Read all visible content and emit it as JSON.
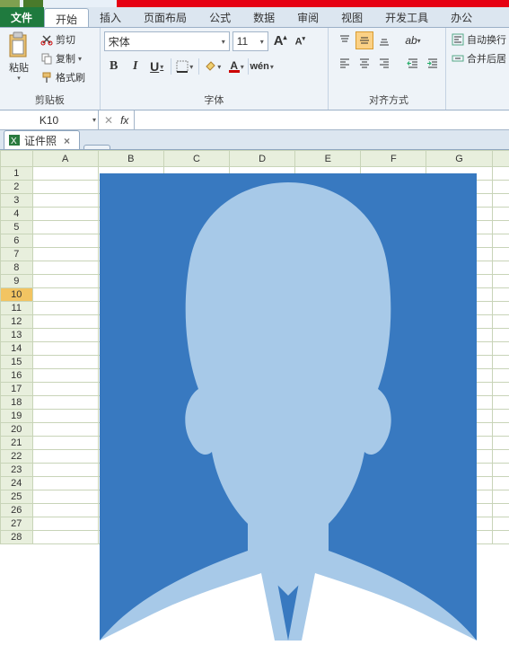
{
  "tabs": {
    "file": "文件",
    "items": [
      "开始",
      "插入",
      "页面布局",
      "公式",
      "数据",
      "审阅",
      "视图",
      "开发工具",
      "办公"
    ]
  },
  "clipboard": {
    "paste": "粘贴",
    "cut": "剪切",
    "copy": "复制",
    "format_painter": "格式刷",
    "group_label": "剪贴板"
  },
  "font": {
    "name": "宋体",
    "size": "11",
    "group_label": "字体",
    "bold": "B",
    "italic": "I",
    "underline": "U",
    "grow": "A",
    "shrink": "A"
  },
  "align": {
    "group_label": "对齐方式"
  },
  "wrap": {
    "wrap_text": "自动换行",
    "merge_center": "合并后居"
  },
  "namebox": "K10",
  "fx_label": "fx",
  "sheet_tab": "证件照",
  "columns": [
    "A",
    "B",
    "C",
    "D",
    "E",
    "F",
    "G",
    ""
  ],
  "rows": [
    "1",
    "2",
    "3",
    "4",
    "5",
    "6",
    "7",
    "8",
    "9",
    "10",
    "11",
    "12",
    "13",
    "14",
    "15",
    "16",
    "17",
    "18",
    "19",
    "20",
    "21",
    "22",
    "23",
    "24",
    "25",
    "26",
    "27",
    "28"
  ],
  "selected_row": "10"
}
